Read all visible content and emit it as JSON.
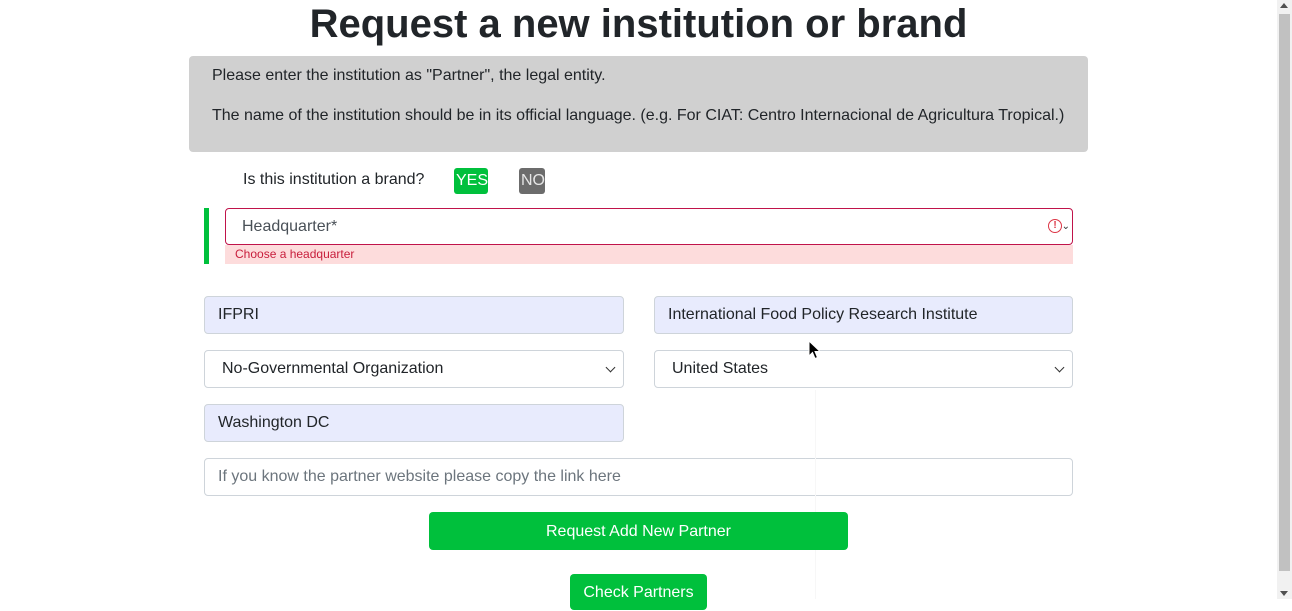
{
  "page": {
    "title": "Request a new institution or brand"
  },
  "info": {
    "line1": "Please enter the institution as \"Partner\", the legal entity.",
    "line2": "The name of the institution should be in its official language. (e.g. For CIAT: Centro Internacional de Agricultura Tropical.)"
  },
  "brand": {
    "question": "Is this institution a brand?",
    "yes_label": "YES",
    "no_label": "NO",
    "selected": "YES"
  },
  "headquarter": {
    "placeholder": "Headquarter*",
    "error": "Choose a headquarter",
    "alert_glyph": "!"
  },
  "form": {
    "acronym": "IFPRI",
    "name": "International Food Policy Research Institute",
    "institution_type": "No-Governmental Organization",
    "country": "United States",
    "city": "Washington DC",
    "website_placeholder": "If you know the partner website please copy the link here"
  },
  "actions": {
    "request_label": "Request Add New Partner",
    "check_label": "Check Partners"
  },
  "colors": {
    "accent_green": "#00c03c",
    "error_red": "#c0134a",
    "info_gray": "#d0d0d0",
    "filled_field": "#e8ebfd"
  }
}
